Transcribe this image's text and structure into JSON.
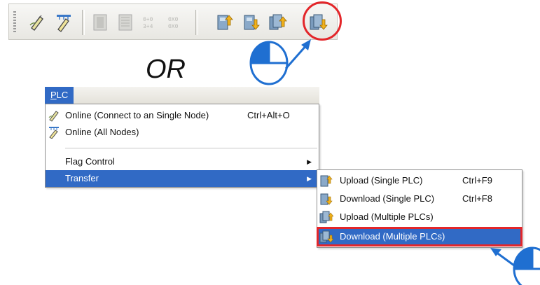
{
  "overlay": {
    "or_text": "OR"
  },
  "toolbar": {
    "buttons": [
      {
        "icon": "online-single-node-icon"
      },
      {
        "icon": "online-all-nodes-icon"
      },
      {
        "icon": "disabled-icon"
      },
      {
        "icon": "disabled-icon"
      },
      {
        "icon": "disabled-icon"
      },
      {
        "icon": "disabled-icon"
      },
      {
        "icon": "upload-single-plc-icon"
      },
      {
        "icon": "download-single-plc-icon"
      },
      {
        "icon": "upload-multiple-plcs-icon"
      },
      {
        "icon": "download-multiple-plcs-icon"
      }
    ],
    "highlight_color": "#e3262a"
  },
  "menu": {
    "title": "PLC",
    "title_mnemonic": "P",
    "title_rest": "LC",
    "items": [
      {
        "label": "Online (Connect to an Single Node)",
        "shortcut": "Ctrl+Alt+O",
        "icon": "online-single-node-icon"
      },
      {
        "label": "Online (All Nodes)",
        "shortcut": "",
        "icon": "online-all-nodes-icon"
      },
      {
        "label": "Flag Control",
        "shortcut": "",
        "submenu": true
      },
      {
        "label": "Transfer",
        "shortcut": "",
        "submenu": true,
        "selected": true
      }
    ]
  },
  "submenu": {
    "items": [
      {
        "label": "Upload (Single PLC)",
        "shortcut": "Ctrl+F9",
        "icon": "upload-single-plc-icon"
      },
      {
        "label": "Download (Single PLC)",
        "shortcut": "Ctrl+F8",
        "icon": "download-single-plc-icon"
      },
      {
        "label": "Upload (Multiple PLCs)",
        "shortcut": "",
        "icon": "upload-multiple-plcs-icon"
      },
      {
        "label": "Download (Multiple PLCs)",
        "shortcut": "",
        "icon": "download-multiple-plcs-icon",
        "selected": true
      }
    ]
  },
  "colors": {
    "selection": "#316ac5",
    "highlight": "#e3262a",
    "pointer": "#1f6fd1"
  }
}
